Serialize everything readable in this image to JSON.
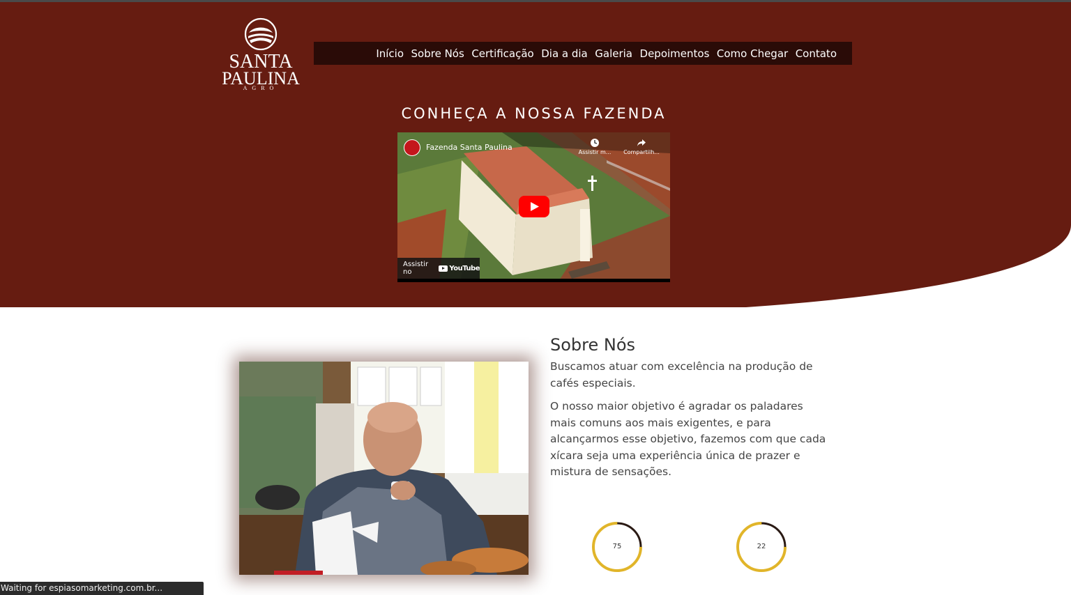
{
  "logo": {
    "line1": "SANTA",
    "line2": "PAULINA",
    "line3": "AGRO",
    "emblem_icon": "coffee-landscape-emblem-icon"
  },
  "nav": {
    "items": [
      {
        "label": "Início"
      },
      {
        "label": "Sobre Nós"
      },
      {
        "label": "Certificação"
      },
      {
        "label": "Dia a dia"
      },
      {
        "label": "Galeria"
      },
      {
        "label": "Depoimentos"
      },
      {
        "label": "Como Chegar"
      },
      {
        "label": "Contato"
      }
    ]
  },
  "hero": {
    "title": "CONHEÇA A NOSSA FAZENDA"
  },
  "video": {
    "title": "Fazenda Santa Paulina",
    "watch_later": "Assistir m...",
    "share": "Compartilh...",
    "watch_on": "Assistir no",
    "youtube": "YouTube"
  },
  "about": {
    "title": "Sobre Nós",
    "paragraph1": "Buscamos atuar com excelência na produção de cafés especiais.",
    "paragraph2": "O nosso maior objetivo é agradar os paladares mais comuns aos mais exigentes, e para alcançarmos esse objetivo, fazemos com que cada xícara seja uma experiência única de prazer e mistura de sensações.",
    "counters": [
      {
        "value": "75",
        "progress": 0.75
      },
      {
        "value": "22",
        "progress": 0.75
      }
    ]
  },
  "status_bar": {
    "text": "Waiting for espiasomarketing.com.br..."
  },
  "colors": {
    "hero_bg": "#661c11",
    "nav_bg": "#2a0b07",
    "counter_ring": "#e1b52a",
    "counter_track": "#2a1a14"
  }
}
